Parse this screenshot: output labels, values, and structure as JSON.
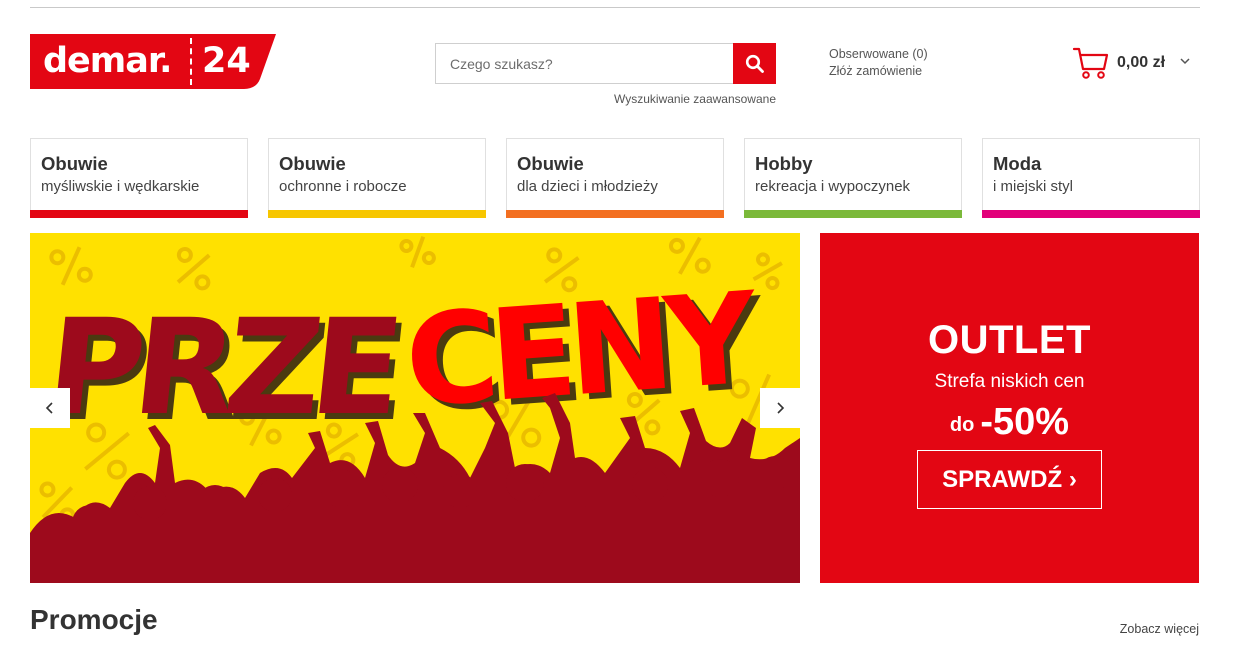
{
  "logo": {
    "brand": "demar.",
    "number": "24"
  },
  "search": {
    "placeholder": "Czego szukasz?",
    "value": "",
    "advanced_label": "Wyszukiwanie zaawansowane"
  },
  "header": {
    "watched_label": "Obserwowane (0)",
    "order_label": "Złóż zamówienie"
  },
  "cart": {
    "value": "0,00 zł"
  },
  "categories": [
    {
      "title": "Obuwie",
      "subtitle": "myśliwskie i wędkarskie",
      "color": "#e30613"
    },
    {
      "title": "Obuwie",
      "subtitle": "ochronne i robocze",
      "color": "#f7c600"
    },
    {
      "title": "Obuwie",
      "subtitle": "dla dzieci i młodzieży",
      "color": "#f36f21"
    },
    {
      "title": "Hobby",
      "subtitle": "rekreacja i wypoczynek",
      "color": "#7bb93a"
    },
    {
      "title": "Moda",
      "subtitle": "i miejski styl",
      "color": "#e2007a"
    }
  ],
  "banner": {
    "text_part1": "PRZE",
    "text_part2": "CENY",
    "colors": {
      "background": "#ffe100",
      "dark_red": "#9d0a1c",
      "bright_red": "#ff0000",
      "percent": "#e8b800"
    }
  },
  "outlet": {
    "title": "OUTLET",
    "subtitle": "Strefa niskich cen",
    "discount_prefix": "do",
    "discount": "-50%",
    "button_label": "SPRAWDŹ",
    "button_chevron": "›",
    "color": "#e30613"
  },
  "promotions": {
    "title": "Promocje",
    "see_more": "Zobacz więcej"
  },
  "icons": [
    "search-icon",
    "cart-icon",
    "chevron-down-icon",
    "arrow-left-icon",
    "arrow-right-icon",
    "chevron-right-icon"
  ]
}
